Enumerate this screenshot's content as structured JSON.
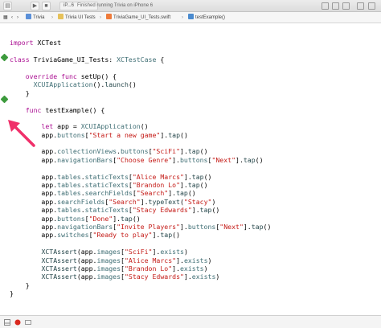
{
  "toolbar": {
    "scheme_label": "iP...6",
    "status_text": "Finished running Trivia on iPhone 6"
  },
  "jumpbar": {
    "crumbs": [
      "Trivia",
      "Trivia UI Tests",
      "TriviaGame_UI_Tests.swift",
      "testExample()"
    ]
  },
  "editor": {
    "lines": [
      [],
      [
        {
          "t": "import",
          "c": "kw"
        },
        {
          "t": " XCTest"
        }
      ],
      [],
      [
        {
          "t": "class",
          "c": "kw"
        },
        {
          "t": " TriviaGame_UI_Tests: "
        },
        {
          "t": "XCTestCase",
          "c": "type"
        },
        {
          "t": " {"
        }
      ],
      [],
      [
        {
          "t": "    "
        },
        {
          "t": "override func",
          "c": "kw"
        },
        {
          "t": " setUp() {"
        }
      ],
      [
        {
          "t": "      "
        },
        {
          "t": "XCUIApplication",
          "c": "type"
        },
        {
          "t": "()."
        },
        {
          "t": "launch",
          "c": "method"
        },
        {
          "t": "()"
        }
      ],
      [
        {
          "t": "    }"
        }
      ],
      [],
      [
        {
          "t": "    "
        },
        {
          "t": "func",
          "c": "kw"
        },
        {
          "t": " testExample() {"
        }
      ],
      [],
      [
        {
          "t": "        "
        },
        {
          "t": "let",
          "c": "kw"
        },
        {
          "t": " app = "
        },
        {
          "t": "XCUIApplication",
          "c": "type"
        },
        {
          "t": "()"
        }
      ],
      [
        {
          "t": "        app."
        },
        {
          "t": "buttons",
          "c": "type"
        },
        {
          "t": "["
        },
        {
          "t": "\"Start a new game\"",
          "c": "str"
        },
        {
          "t": "]",
          "c": ""
        },
        {
          "t": "."
        },
        {
          "t": "tap",
          "c": "method"
        },
        {
          "t": "()"
        }
      ],
      [],
      [
        {
          "t": "        app."
        },
        {
          "t": "collectionViews",
          "c": "type"
        },
        {
          "t": "."
        },
        {
          "t": "buttons",
          "c": "type"
        },
        {
          "t": "["
        },
        {
          "t": "\"SciFi\"",
          "c": "str"
        },
        {
          "t": "]."
        },
        {
          "t": "tap",
          "c": "method"
        },
        {
          "t": "()"
        }
      ],
      [
        {
          "t": "        app."
        },
        {
          "t": "navigationBars",
          "c": "type"
        },
        {
          "t": "["
        },
        {
          "t": "\"Choose Genre\"",
          "c": "str"
        },
        {
          "t": "]."
        },
        {
          "t": "buttons",
          "c": "type"
        },
        {
          "t": "["
        },
        {
          "t": "\"Next\"",
          "c": "str"
        },
        {
          "t": "]."
        },
        {
          "t": "tap",
          "c": "method"
        },
        {
          "t": "()"
        }
      ],
      [],
      [
        {
          "t": "        app."
        },
        {
          "t": "tables",
          "c": "type"
        },
        {
          "t": "."
        },
        {
          "t": "staticTexts",
          "c": "type"
        },
        {
          "t": "["
        },
        {
          "t": "\"Alice Marcs\"",
          "c": "str"
        },
        {
          "t": "]."
        },
        {
          "t": "tap",
          "c": "method"
        },
        {
          "t": "()"
        }
      ],
      [
        {
          "t": "        app."
        },
        {
          "t": "tables",
          "c": "type"
        },
        {
          "t": "."
        },
        {
          "t": "staticTexts",
          "c": "type"
        },
        {
          "t": "["
        },
        {
          "t": "\"Brandon Lo\"",
          "c": "str"
        },
        {
          "t": "]."
        },
        {
          "t": "tap",
          "c": "method"
        },
        {
          "t": "()"
        }
      ],
      [
        {
          "t": "        app."
        },
        {
          "t": "tables",
          "c": "type"
        },
        {
          "t": "."
        },
        {
          "t": "searchFields",
          "c": "type"
        },
        {
          "t": "["
        },
        {
          "t": "\"Search\"",
          "c": "str"
        },
        {
          "t": "]."
        },
        {
          "t": "tap",
          "c": "method"
        },
        {
          "t": "()"
        }
      ],
      [
        {
          "t": "        app."
        },
        {
          "t": "searchFields",
          "c": "type"
        },
        {
          "t": "["
        },
        {
          "t": "\"Search\"",
          "c": "str"
        },
        {
          "t": "]."
        },
        {
          "t": "typeText",
          "c": "method"
        },
        {
          "t": "("
        },
        {
          "t": "\"Stacy\"",
          "c": "str"
        },
        {
          "t": ")"
        }
      ],
      [
        {
          "t": "        app."
        },
        {
          "t": "tables",
          "c": "type"
        },
        {
          "t": "."
        },
        {
          "t": "staticTexts",
          "c": "type"
        },
        {
          "t": "["
        },
        {
          "t": "\"Stacy Edwards\"",
          "c": "str"
        },
        {
          "t": "]."
        },
        {
          "t": "tap",
          "c": "method"
        },
        {
          "t": "()"
        }
      ],
      [
        {
          "t": "        app."
        },
        {
          "t": "buttons",
          "c": "type"
        },
        {
          "t": "["
        },
        {
          "t": "\"Done\"",
          "c": "str"
        },
        {
          "t": "]."
        },
        {
          "t": "tap",
          "c": "method"
        },
        {
          "t": "()"
        }
      ],
      [
        {
          "t": "        app."
        },
        {
          "t": "navigationBars",
          "c": "type"
        },
        {
          "t": "["
        },
        {
          "t": "\"Invite Players\"",
          "c": "str"
        },
        {
          "t": "]."
        },
        {
          "t": "buttons",
          "c": "type"
        },
        {
          "t": "["
        },
        {
          "t": "\"Next\"",
          "c": "str"
        },
        {
          "t": "]."
        },
        {
          "t": "tap",
          "c": "method"
        },
        {
          "t": "()"
        }
      ],
      [
        {
          "t": "        app."
        },
        {
          "t": "switches",
          "c": "type"
        },
        {
          "t": "["
        },
        {
          "t": "\"Ready to play\"",
          "c": "str"
        },
        {
          "t": "]."
        },
        {
          "t": "tap",
          "c": "method"
        },
        {
          "t": "()"
        }
      ],
      [],
      [
        {
          "t": "        "
        },
        {
          "t": "XCTAssert",
          "c": "method"
        },
        {
          "t": "(app."
        },
        {
          "t": "images",
          "c": "type"
        },
        {
          "t": "["
        },
        {
          "t": "\"SciFi\"",
          "c": "str"
        },
        {
          "t": "]."
        },
        {
          "t": "exists",
          "c": "type"
        },
        {
          "t": ")"
        }
      ],
      [
        {
          "t": "        "
        },
        {
          "t": "XCTAssert",
          "c": "method"
        },
        {
          "t": "(app."
        },
        {
          "t": "images",
          "c": "type"
        },
        {
          "t": "["
        },
        {
          "t": "\"Alice Marcs\"",
          "c": "str"
        },
        {
          "t": "]."
        },
        {
          "t": "exists",
          "c": "type"
        },
        {
          "t": ")"
        }
      ],
      [
        {
          "t": "        "
        },
        {
          "t": "XCTAssert",
          "c": "method"
        },
        {
          "t": "(app."
        },
        {
          "t": "images",
          "c": "type"
        },
        {
          "t": "["
        },
        {
          "t": "\"Brandon Lo\"",
          "c": "str"
        },
        {
          "t": "]."
        },
        {
          "t": "exists",
          "c": "type"
        },
        {
          "t": ")"
        }
      ],
      [
        {
          "t": "        "
        },
        {
          "t": "XCTAssert",
          "c": "method"
        },
        {
          "t": "(app."
        },
        {
          "t": "images",
          "c": "type"
        },
        {
          "t": "["
        },
        {
          "t": "\"Stacy Edwards\"",
          "c": "str"
        },
        {
          "t": "]."
        },
        {
          "t": "exists",
          "c": "type"
        },
        {
          "t": ")"
        }
      ],
      [
        {
          "t": "    }"
        }
      ],
      [
        {
          "t": "}"
        }
      ]
    ]
  },
  "colors": {
    "test_diamond": "#3c9a3c",
    "annotation_arrow": "#f0306a",
    "stop_button": "#d9281e"
  }
}
